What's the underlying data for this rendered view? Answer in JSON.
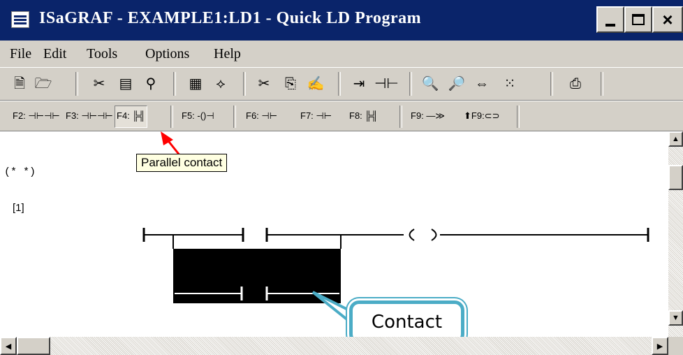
{
  "window": {
    "title": "ISaGRAF - EXAMPLE1:LD1 - Quick LD Program",
    "minimize_label": "_",
    "close_label": "×"
  },
  "menu": [
    {
      "label": "File"
    },
    {
      "label": "Edit"
    },
    {
      "label": "Tools"
    },
    {
      "label": "Options"
    },
    {
      "label": "Help"
    }
  ],
  "toolbar_icons": [
    "new-icon",
    "open-icon",
    "cut-bin-icon",
    "monitor-icon",
    "wizard-icon",
    "graph-icon",
    "tree-icon",
    "scissors-icon",
    "copy-icon",
    "paint-icon",
    "jump-icon",
    "contact-icon",
    "zoom-out-icon",
    "zoom-in-icon",
    "fit-icon",
    "grid-icon",
    "print-icon"
  ],
  "function_keys": [
    {
      "label": "F2: ⊣⊢⊣⊢",
      "pressed": false
    },
    {
      "label": "F3: ⊣⊢⊣⊢",
      "pressed": false
    },
    {
      "label": "F4: ╠╣",
      "pressed": true
    },
    {
      "label": "F5: -()⊣",
      "pressed": false
    },
    {
      "label": "F6: ⊣⊢",
      "pressed": false
    },
    {
      "label": "F7: ⊣⊢",
      "pressed": false
    },
    {
      "label": "F8: ╠╣",
      "pressed": false
    },
    {
      "label": "F9: —≫",
      "pressed": false
    },
    {
      "label": "⬆F9:⊂⊃",
      "pressed": false
    }
  ],
  "editor": {
    "comment": "(*  *)",
    "rung_number": "[1]"
  },
  "tooltip": "Parallel contact",
  "callout": "Contact",
  "colors": {
    "titlebar": "#0a246a",
    "arrow": "#ff0000",
    "callout_border": "#4bacc6"
  }
}
